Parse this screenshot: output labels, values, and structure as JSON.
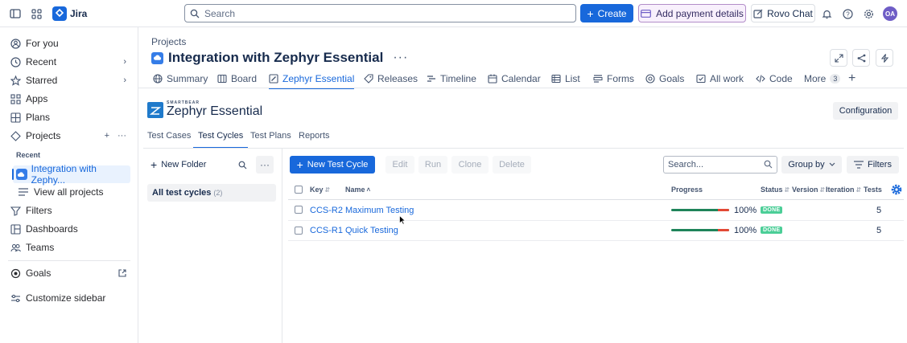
{
  "topbar": {
    "app_name": "Jira",
    "search_placeholder": "Search",
    "create_label": "Create",
    "payment_label": "Add payment details",
    "rovo_label": "Rovo Chat",
    "avatar_initials": "OA"
  },
  "sidebar": {
    "for_you": "For you",
    "recent": "Recent",
    "starred": "Starred",
    "apps": "Apps",
    "plans": "Plans",
    "projects": "Projects",
    "recent_section": "Recent",
    "project_name": "Integration with Zephy...",
    "view_all": "View all projects",
    "filters": "Filters",
    "dashboards": "Dashboards",
    "teams": "Teams",
    "goals": "Goals",
    "customize": "Customize sidebar"
  },
  "header": {
    "breadcrumb": "Projects",
    "title": "Integration with Zephyr Essential",
    "tabs": [
      {
        "label": "Summary",
        "icon": "globe-icon"
      },
      {
        "label": "Board",
        "icon": "board-icon"
      },
      {
        "label": "Zephyr Essential",
        "icon": "zephyr-icon"
      },
      {
        "label": "Releases",
        "icon": "releases-icon"
      },
      {
        "label": "Timeline",
        "icon": "timeline-icon"
      },
      {
        "label": "Calendar",
        "icon": "calendar-icon"
      },
      {
        "label": "List",
        "icon": "list-icon"
      },
      {
        "label": "Forms",
        "icon": "forms-icon"
      },
      {
        "label": "Goals",
        "icon": "goals-icon"
      },
      {
        "label": "All work",
        "icon": "all-work-icon"
      },
      {
        "label": "Code",
        "icon": "code-icon"
      },
      {
        "label": "More",
        "icon": ""
      }
    ],
    "more_count": "3"
  },
  "zephyr": {
    "logo_small": "SMARTBEAR",
    "logo_big": "Zephyr Essential",
    "configuration": "Configuration",
    "subtabs": [
      "Test Cases",
      "Test Cycles",
      "Test Plans",
      "Reports"
    ],
    "new_folder": "New Folder",
    "all_cycles": "All test cycles",
    "all_cycles_count": "(2)",
    "toolbar": {
      "new_cycle": "New Test Cycle",
      "edit": "Edit",
      "run": "Run",
      "clone": "Clone",
      "delete": "Delete",
      "search_placeholder": "Search...",
      "group_by": "Group by",
      "filters": "Filters"
    },
    "columns": {
      "key": "Key",
      "name": "Name",
      "progress": "Progress",
      "status": "Status",
      "version": "Version",
      "iteration": "Iteration",
      "tests": "Tests"
    },
    "rows": [
      {
        "key": "CCS-R2",
        "name": "Maximum Testing",
        "progress_pct": "100%",
        "progress_green": 0.8,
        "status": "DONE",
        "tests": "5"
      },
      {
        "key": "CCS-R1",
        "name": "Quick Testing",
        "progress_pct": "100%",
        "progress_green": 0.8,
        "status": "DONE",
        "tests": "5"
      }
    ]
  },
  "colors": {
    "accent": "#1868db",
    "done": "#4bce97",
    "progress_pass": "#1f845a",
    "progress_fail": "#e34935"
  }
}
